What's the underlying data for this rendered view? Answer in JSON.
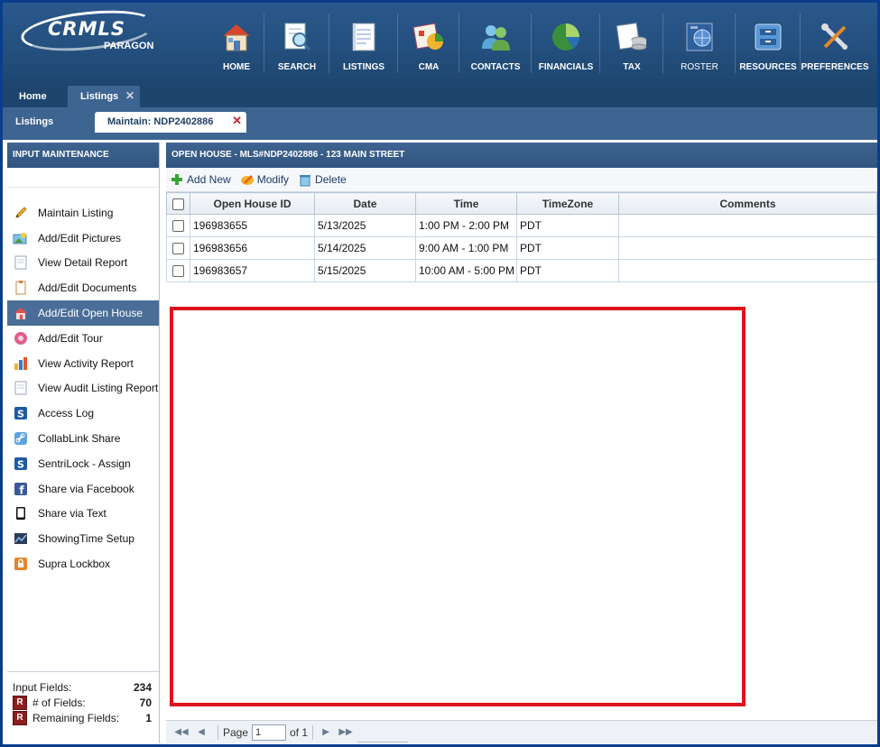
{
  "header": {
    "logo_text": "CRMLS",
    "logo_sub": "PARAGON",
    "nav": [
      {
        "label": "HOME",
        "icon": "home-icon"
      },
      {
        "label": "SEARCH",
        "icon": "search-icon"
      },
      {
        "label": "LISTINGS",
        "icon": "listings-icon"
      },
      {
        "label": "CMA",
        "icon": "cma-icon"
      },
      {
        "label": "CONTACTS",
        "icon": "contacts-icon"
      },
      {
        "label": "FINANCIALS",
        "icon": "financials-icon"
      },
      {
        "label": "TAX",
        "icon": "tax-icon"
      },
      {
        "label": "ROSTER",
        "icon": "roster-icon"
      },
      {
        "label": "RESOURCES",
        "icon": "resources-icon"
      },
      {
        "label": "PREFERENCES",
        "icon": "preferences-icon"
      }
    ]
  },
  "tabs": {
    "home": "Home",
    "listings": "Listings",
    "sub_listings": "Listings",
    "sub_maintain": "Maintain: NDP2402886",
    "close_glyph": "✕"
  },
  "sidebar": {
    "title": "INPUT MAINTENANCE",
    "items": [
      {
        "label": "Maintain Listing",
        "icon": "pencil-icon"
      },
      {
        "label": "Add/Edit Pictures",
        "icon": "pictures-icon"
      },
      {
        "label": "View Detail Report",
        "icon": "document-icon"
      },
      {
        "label": "Add/Edit Documents",
        "icon": "documents-icon"
      },
      {
        "label": "Add/Edit Open House",
        "icon": "open-house-icon"
      },
      {
        "label": "Add/Edit Tour",
        "icon": "tour-icon"
      },
      {
        "label": "View Activity Report",
        "icon": "activity-report-icon"
      },
      {
        "label": "View Audit Listing Report",
        "icon": "audit-report-icon"
      },
      {
        "label": "Access Log",
        "icon": "access-log-icon"
      },
      {
        "label": "CollabLink Share",
        "icon": "link-icon"
      },
      {
        "label": "SentriLock - Assign",
        "icon": "sentrilock-icon"
      },
      {
        "label": "Share via Facebook",
        "icon": "facebook-icon"
      },
      {
        "label": "Share via Text",
        "icon": "phone-icon"
      },
      {
        "label": "ShowingTime Setup",
        "icon": "showingtime-icon"
      },
      {
        "label": "Supra Lockbox",
        "icon": "lockbox-icon"
      }
    ],
    "active_index": 4,
    "footer": {
      "input_fields_label": "Input Fields:",
      "input_fields_value": "234",
      "required_badge": "R",
      "num_fields_label": "# of Fields:",
      "num_fields_value": "70",
      "remaining_label": "Remaining Fields:",
      "remaining_value": "1"
    }
  },
  "main": {
    "title": "OPEN HOUSE - MLS#NDP2402886 - 123 MAIN STREET",
    "toolbar": {
      "add_new": "Add New",
      "modify": "Modify",
      "delete": "Delete"
    },
    "columns": [
      "Open House ID",
      "Date",
      "Time",
      "TimeZone",
      "Comments"
    ],
    "rows": [
      {
        "id": "196983655",
        "date": "5/13/2025",
        "time": "1:00 PM - 2:00 PM",
        "tz": "PDT",
        "comments": ""
      },
      {
        "id": "196983656",
        "date": "5/14/2025",
        "time": "9:00 AM - 1:00 PM",
        "tz": "PDT",
        "comments": ""
      },
      {
        "id": "196983657",
        "date": "5/15/2025",
        "time": "10:00 AM - 5:00 PM",
        "tz": "PDT",
        "comments": ""
      }
    ],
    "pager": {
      "page_label": "Page",
      "page_value": "1",
      "of_label": "of 1"
    }
  },
  "colors": {
    "header_blue": "#24507f",
    "tab_blue": "#3e6491",
    "highlight_red": "#e0121b",
    "required_red": "#8b1e1e"
  }
}
